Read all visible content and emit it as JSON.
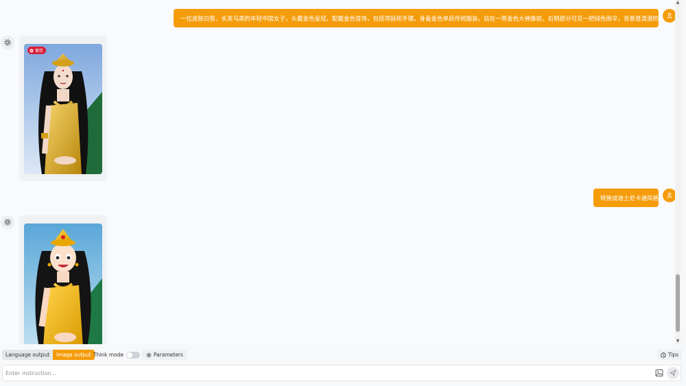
{
  "messages": {
    "user_1": "一位皮肤白皙、长发乌黑的年轻中国女子，头戴金色皇冠，配戴金色首饰，包括项链和手镯，身着金色单肩传统服装，站在一尊金色大佛像前，右侧部分可见一把绿色雨伞，背景是清澈的蓝色天空。",
    "user_2": "转换成迪士尼卡通风格",
    "bot_image_1_badge": "保存"
  },
  "toolbar": {
    "language_output": "Language output",
    "image_output": "Image output",
    "think_mode": "Think mode",
    "think_mode_on": false,
    "parameters": "Parameters",
    "tips": "Tips"
  },
  "input": {
    "placeholder": "Enter instruction..."
  },
  "icons": {
    "user_avatar": "user-icon",
    "bot_avatar": "gear-icon",
    "parameters": "settings-icon",
    "tips": "help-icon",
    "upload": "image-icon",
    "send": "send-icon"
  },
  "colors": {
    "accent": "#f59c0b",
    "badge": "#d91e3a"
  }
}
